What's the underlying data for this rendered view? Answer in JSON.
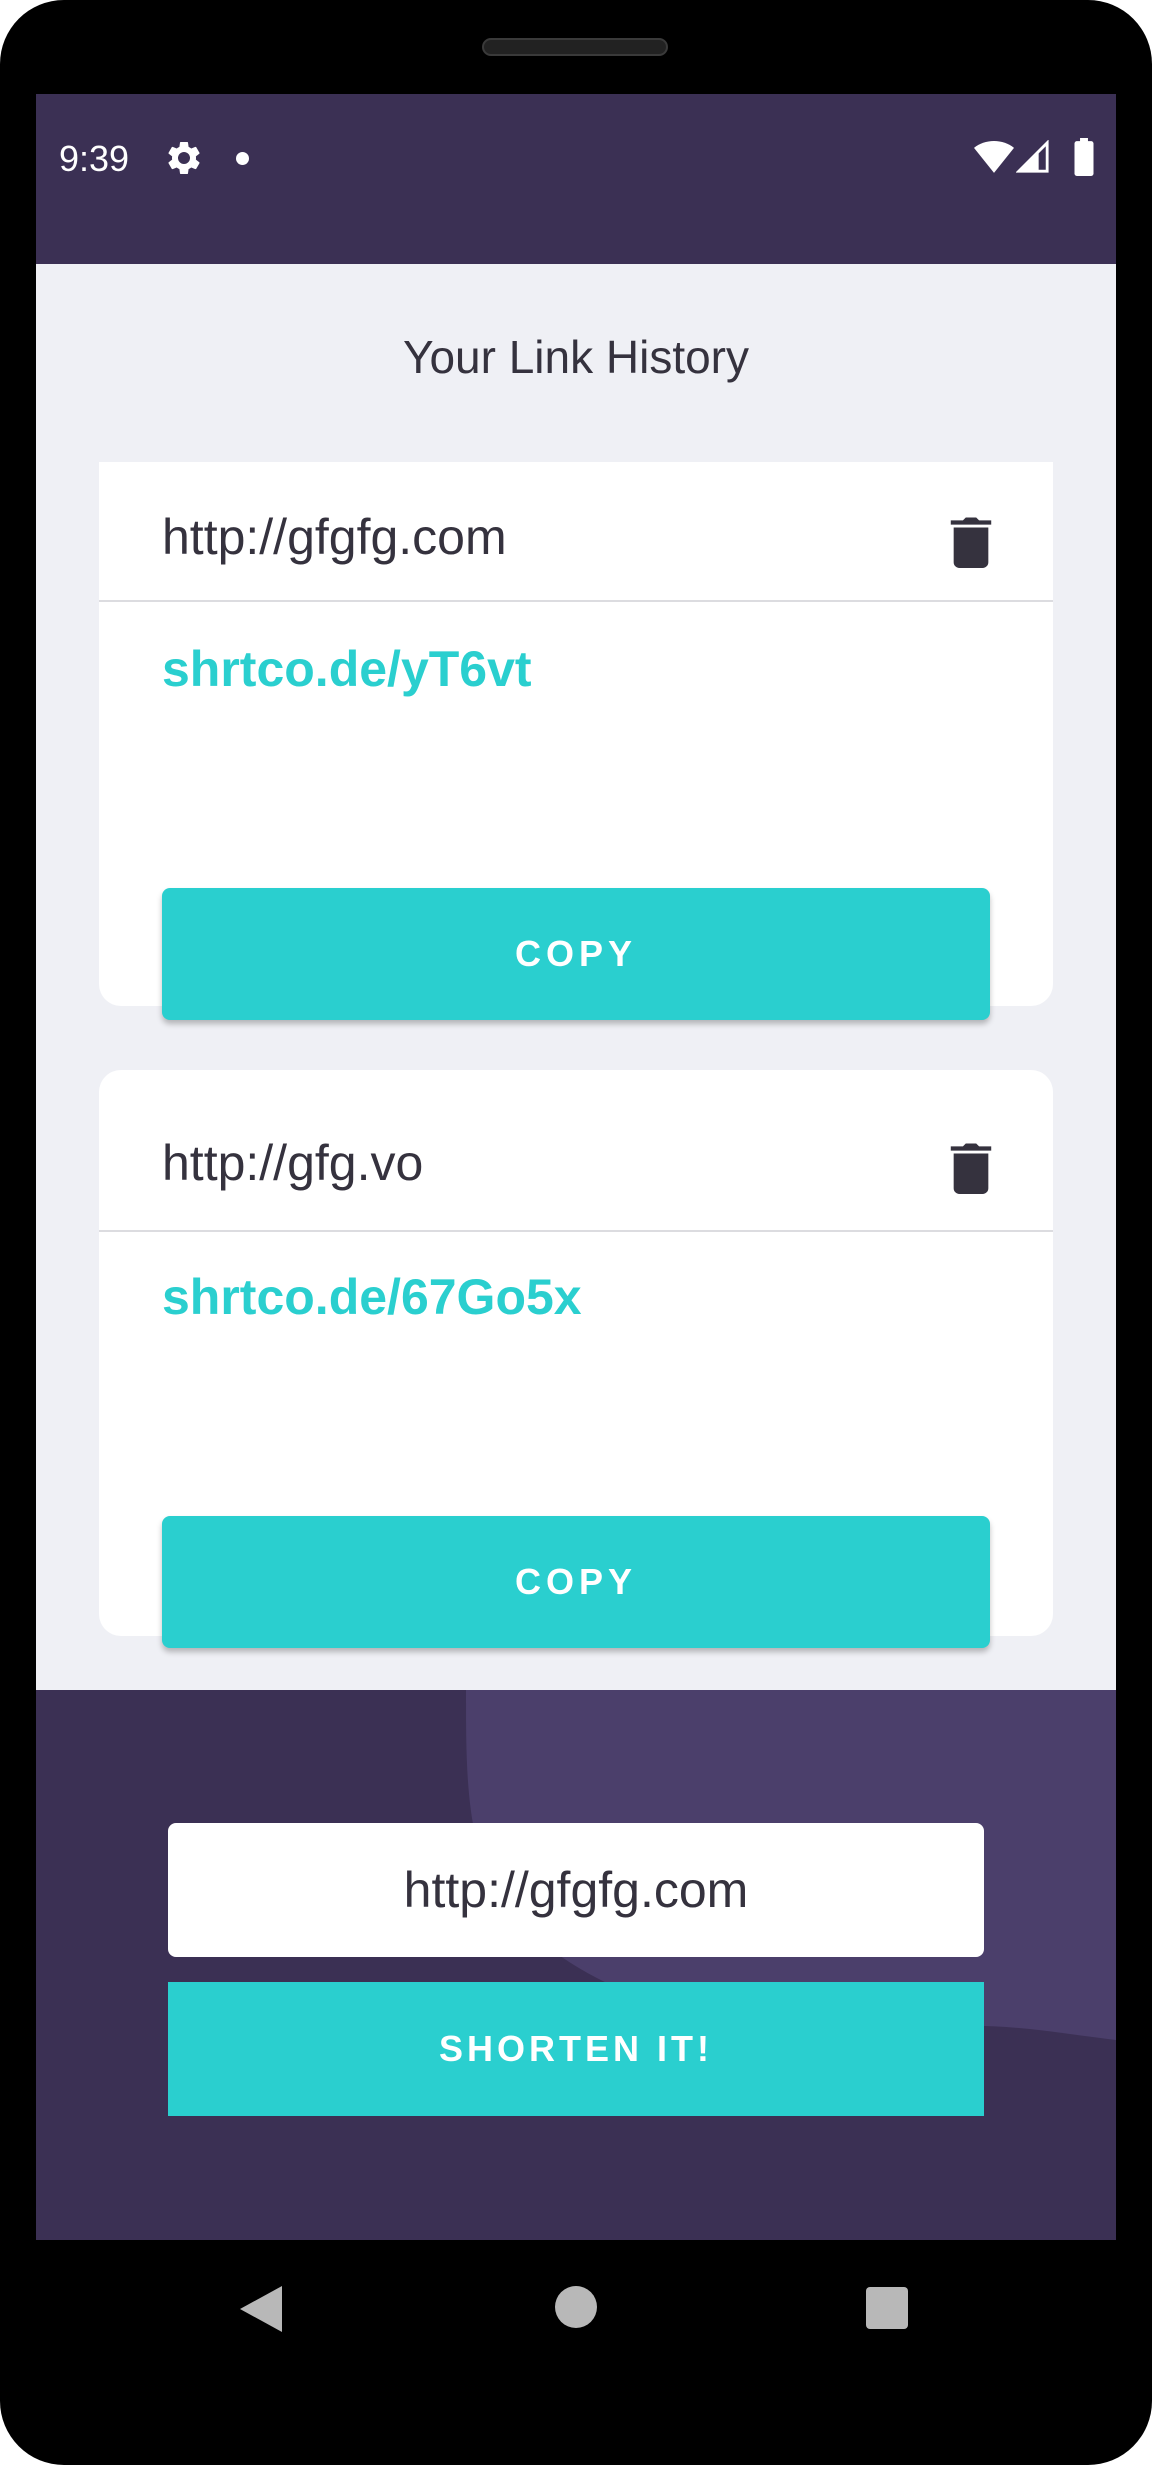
{
  "status_bar": {
    "time": "9:39",
    "icons": [
      "gear-icon",
      "notification-dot-icon",
      "wifi-icon",
      "signal-icon",
      "battery-icon"
    ]
  },
  "page": {
    "title": "Your Link History"
  },
  "links": [
    {
      "original_url": "http://gfgfg.com",
      "short_url": "shrtco.de/yT6vt",
      "copy_label": "COPY"
    },
    {
      "original_url": "http://gfg.vo",
      "short_url": "shrtco.de/67Go5x",
      "copy_label": "COPY"
    }
  ],
  "form": {
    "input_value": "http://gfgfg.com",
    "submit_label": "SHORTEN IT!"
  },
  "nav": {
    "icons": [
      "back-icon",
      "home-icon",
      "recents-icon"
    ]
  },
  "colors": {
    "primary_cyan": "#2acfcf",
    "dark_violet": "#3b3054",
    "text_dark": "#35323e",
    "background": "#eff0f5"
  }
}
